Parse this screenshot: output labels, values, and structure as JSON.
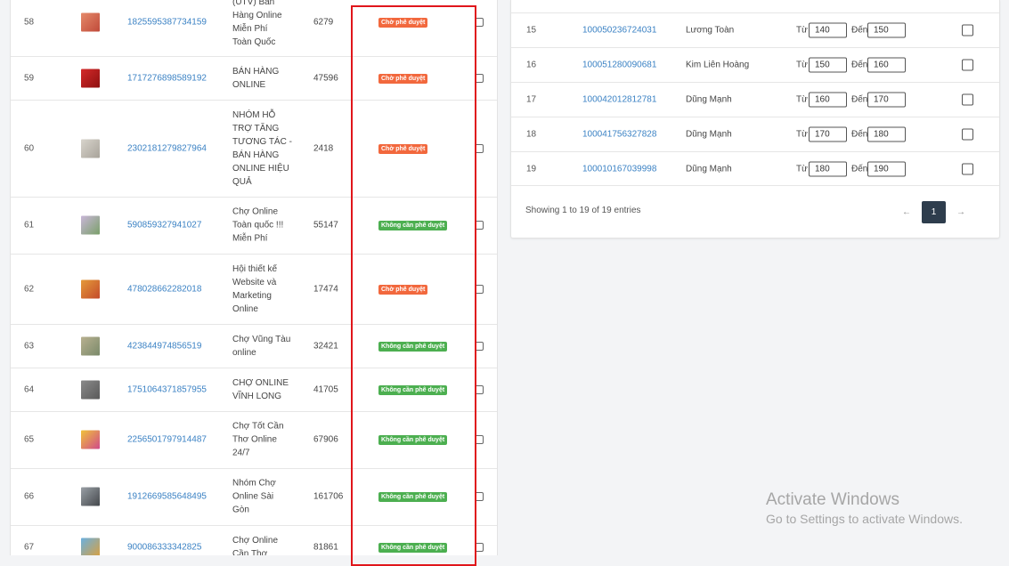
{
  "left_table": {
    "rows": [
      {
        "stt": "58",
        "group_id": "1825595387734159",
        "name_lines": [
          "(UTV) Bán",
          "Hàng Online",
          "Miễn Phí",
          "Toàn Quốc"
        ],
        "members": "6279",
        "status": "Chờ phê duyệt",
        "status_color": "orange"
      },
      {
        "stt": "59",
        "group_id": "1717276898589192",
        "name_lines": [
          "BÁN HÀNG",
          "ONLINE"
        ],
        "members": "47596",
        "status": "Chờ phê duyệt",
        "status_color": "orange"
      },
      {
        "stt": "60",
        "group_id": "2302181279827964",
        "name_lines": [
          "NHÓM HỖ",
          "TRỢ TĂNG",
          "TƯƠNG TÁC -",
          "BÁN HÀNG",
          "ONLINE HIỆU",
          "QUẢ"
        ],
        "members": "2418",
        "status": "Chờ phê duyệt",
        "status_color": "orange"
      },
      {
        "stt": "61",
        "group_id": "590859327941027",
        "name_lines": [
          "Chợ Online",
          "Toàn quốc !!!",
          "Miễn Phí"
        ],
        "members": "55147",
        "status": "Không cần phê duyệt",
        "status_color": "green"
      },
      {
        "stt": "62",
        "group_id": "478028662282018",
        "name_lines": [
          "Hội thiết kế",
          "Website và",
          "Marketing",
          "Online"
        ],
        "members": "17474",
        "status": "Chờ phê duyệt",
        "status_color": "orange"
      },
      {
        "stt": "63",
        "group_id": "423844974856519",
        "name_lines": [
          "Chợ Vũng Tàu",
          "online"
        ],
        "members": "32421",
        "status": "Không cần phê duyệt",
        "status_color": "green"
      },
      {
        "stt": "64",
        "group_id": "1751064371857955",
        "name_lines": [
          "CHỢ ONLINE",
          "VĨNH LONG"
        ],
        "members": "41705",
        "status": "Không cần phê duyệt",
        "status_color": "green"
      },
      {
        "stt": "65",
        "group_id": "2256501797914487",
        "name_lines": [
          "Chợ Tốt Cần",
          "Thơ Online",
          "24/7"
        ],
        "members": "67906",
        "status": "Không cần phê duyệt",
        "status_color": "green"
      },
      {
        "stt": "66",
        "group_id": "1912669585648495",
        "name_lines": [
          "Nhóm Chợ",
          "Online Sài",
          "Gòn"
        ],
        "members": "161706",
        "status": "Không cần phê duyệt",
        "status_color": "green"
      },
      {
        "stt": "67",
        "group_id": "900086333342825",
        "name_lines": [
          "Chợ Online",
          "Cần Thơ"
        ],
        "members": "81861",
        "status": "Không cần phê duyệt",
        "status_color": "green"
      }
    ]
  },
  "right_table": {
    "from_label": "Từ",
    "to_label": "Đến",
    "rows": [
      {
        "stt": "15",
        "uid": "100050236724031",
        "name": "Lương Toàn",
        "from": "140",
        "to": "150"
      },
      {
        "stt": "16",
        "uid": "100051280090681",
        "name": "Kim Liên Hoàng",
        "from": "150",
        "to": "160"
      },
      {
        "stt": "17",
        "uid": "100042012812781",
        "name": "Dũng Mạnh",
        "from": "160",
        "to": "170"
      },
      {
        "stt": "18",
        "uid": "100041756327828",
        "name": "Dũng Mạnh",
        "from": "170",
        "to": "180"
      },
      {
        "stt": "19",
        "uid": "100010167039998",
        "name": "Dũng Mạnh",
        "from": "180",
        "to": "190"
      }
    ],
    "showing_text": "Showing 1 to 19 of 19 entries",
    "pagination": {
      "prev": "←",
      "current_page": "1",
      "next": "→"
    }
  },
  "watermark": {
    "title": "Activate Windows",
    "subtitle": "Go to Settings to activate Windows."
  },
  "colors": {
    "link": "#3b82c4",
    "badge_orange": "#f2683d",
    "badge_green": "#4caf50",
    "highlight": "#e0161b",
    "page_active": "#2e3d4d"
  }
}
